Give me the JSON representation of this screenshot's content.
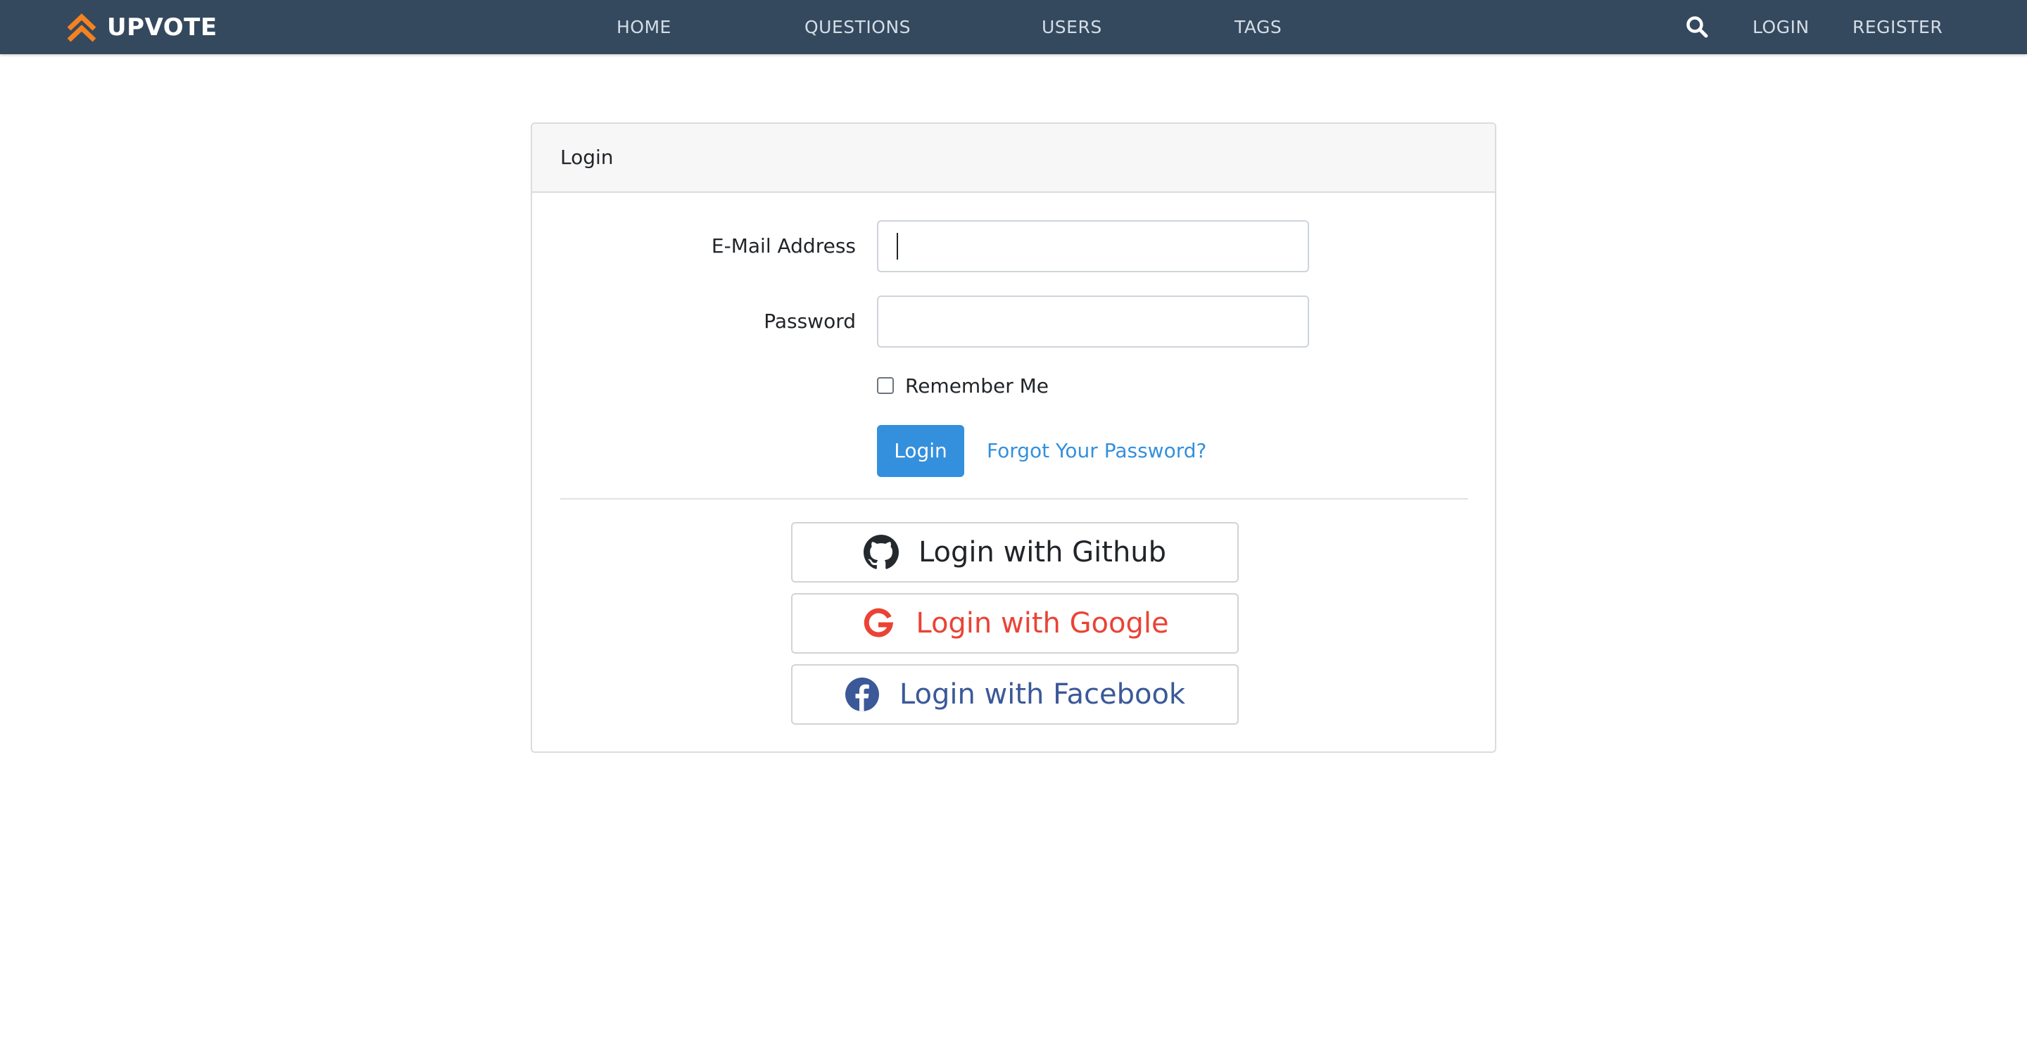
{
  "navbar": {
    "brand": "UPVOTE",
    "brand_icon": "double-chevron-up-icon",
    "links": {
      "home": "HOME",
      "questions": "QUESTIONS",
      "users": "USERS",
      "tags": "TAGS"
    },
    "search_icon": "search-icon",
    "login": "LOGIN",
    "register": "REGISTER"
  },
  "login_card": {
    "header": "Login",
    "email_label": "E-Mail Address",
    "email_value": "",
    "password_label": "Password",
    "password_value": "",
    "remember_label": "Remember Me",
    "remember_checked": false,
    "login_button": "Login",
    "forgot_link": "Forgot Your Password?"
  },
  "social": {
    "github": {
      "label": "Login with Github",
      "icon": "github-icon"
    },
    "google": {
      "label": "Login with Google",
      "icon": "google-icon"
    },
    "facebook": {
      "label": "Login with Facebook",
      "icon": "facebook-icon"
    }
  },
  "colors": {
    "navbar_bg": "#34495e",
    "brand_accent": "#f58220",
    "primary": "#3490dc",
    "google_red": "#ea4335",
    "facebook_blue": "#3b5998"
  }
}
